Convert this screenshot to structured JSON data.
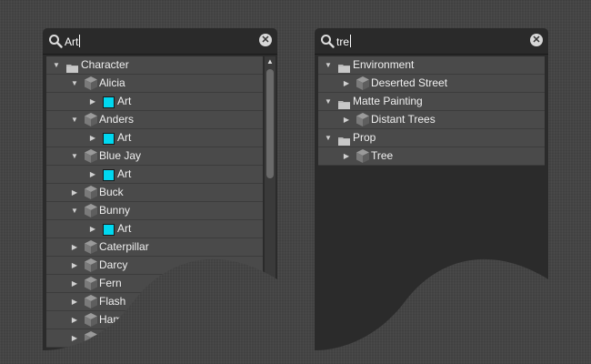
{
  "left_panel": {
    "search": {
      "query": "Art"
    },
    "rows": [
      {
        "label": "Character",
        "type": "folder",
        "level": 0,
        "expanded": true
      },
      {
        "label": "Alicia",
        "type": "cube",
        "level": 1,
        "expanded": true
      },
      {
        "label": "Art",
        "type": "swatch",
        "level": 2,
        "expanded": false
      },
      {
        "label": "Anders",
        "type": "cube",
        "level": 1,
        "expanded": true
      },
      {
        "label": "Art",
        "type": "swatch",
        "level": 2,
        "expanded": false
      },
      {
        "label": "Blue Jay",
        "type": "cube",
        "level": 1,
        "expanded": true
      },
      {
        "label": "Art",
        "type": "swatch",
        "level": 2,
        "expanded": false
      },
      {
        "label": "Buck",
        "type": "cube",
        "level": 1,
        "expanded": false
      },
      {
        "label": "Bunny",
        "type": "cube",
        "level": 1,
        "expanded": true
      },
      {
        "label": "Art",
        "type": "swatch",
        "level": 2,
        "expanded": false
      },
      {
        "label": "Caterpillar",
        "type": "cube",
        "level": 1,
        "expanded": false
      },
      {
        "label": "Darcy",
        "type": "cube",
        "level": 1,
        "expanded": false
      },
      {
        "label": "Fern",
        "type": "cube",
        "level": 1,
        "expanded": false
      },
      {
        "label": "Flash",
        "type": "cube",
        "level": 1,
        "expanded": false
      },
      {
        "label": "Hamster",
        "type": "cube",
        "level": 1,
        "expanded": false
      },
      {
        "label": "",
        "type": "cube",
        "level": 1,
        "expanded": false
      }
    ]
  },
  "right_panel": {
    "search": {
      "query": "tre"
    },
    "rows": [
      {
        "label": "Environment",
        "type": "folder",
        "level": 0,
        "expanded": true
      },
      {
        "label": "Deserted Street",
        "type": "cube",
        "level": 1,
        "expanded": false
      },
      {
        "label": "Matte Painting",
        "type": "folder",
        "level": 0,
        "expanded": true
      },
      {
        "label": "Distant Trees",
        "type": "cube",
        "level": 1,
        "expanded": false
      },
      {
        "label": "Prop",
        "type": "folder",
        "level": 0,
        "expanded": true
      },
      {
        "label": "Tree",
        "type": "cube",
        "level": 1,
        "expanded": false
      }
    ]
  },
  "colors": {
    "swatch": "#00d8f0",
    "row": "#4a4a4a",
    "panel": "#2b2b2b"
  },
  "icons": {
    "search": "magnifier-icon",
    "clear": "clear-circle-x-icon",
    "expanded": "triangle-down-icon",
    "collapsed": "triangle-right-icon",
    "folder": "folder-icon",
    "cube": "cube-asset-icon",
    "swatch": "color-swatch-icon",
    "scroll_up": "scroll-up-arrow-icon"
  }
}
